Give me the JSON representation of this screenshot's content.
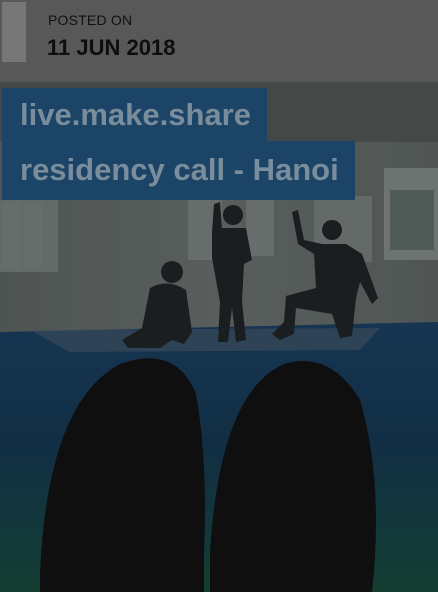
{
  "post": {
    "posted_label": "POSTED ON",
    "date": "11 JUN 2018",
    "title_line1": "live.make.share",
    "title_line2": "residency call - Hanoi"
  },
  "colors": {
    "title_bg": "#1c4466",
    "title_text": "#7a8d9c",
    "page_bg": "#5a5a5a"
  },
  "image": {
    "subject": "dancers-in-studio-photo"
  }
}
